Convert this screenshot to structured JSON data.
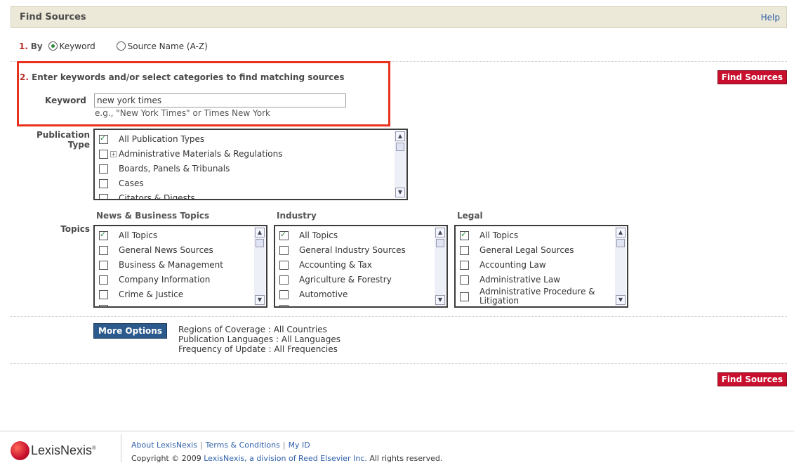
{
  "header": {
    "title": "Find Sources",
    "help": "Help"
  },
  "by": {
    "step": "1.",
    "label": "By",
    "options": [
      {
        "label": "Keyword",
        "selected": true
      },
      {
        "label": "Source Name (A-Z)",
        "selected": false
      }
    ]
  },
  "step2": {
    "num": "2.",
    "text": "Enter keywords and/or select categories to find matching sources"
  },
  "find_button": "Find Sources",
  "keyword": {
    "label": "Keyword",
    "value": "new york times",
    "hint": "e.g., \"New York Times\" or Times New York"
  },
  "publication": {
    "label_line1": "Publication",
    "label_line2": "Type",
    "items": [
      {
        "label": "All Publication Types",
        "checked": true
      },
      {
        "label": "Administrative Materials & Regulations",
        "checked": false,
        "expandable": true
      },
      {
        "label": "Boards, Panels & Tribunals",
        "checked": false
      },
      {
        "label": "Cases",
        "checked": false
      },
      {
        "label": "Citators & Digests",
        "checked": false
      }
    ]
  },
  "topics": {
    "label": "Topics",
    "news": {
      "heading": "News & Business Topics",
      "items": [
        "All Topics",
        "General News Sources",
        "Business & Management",
        "Company Information",
        "Crime & Justice"
      ]
    },
    "industry": {
      "heading": "Industry",
      "items": [
        "All Topics",
        "General Industry Sources",
        "Accounting & Tax",
        "Agriculture & Forestry",
        "Automotive"
      ]
    },
    "legal": {
      "heading": "Legal",
      "items": [
        "All Topics",
        "General Legal Sources",
        "Accounting Law",
        "Administrative Law",
        "Administrative Procedure &",
        "Litigation"
      ]
    }
  },
  "more_options": {
    "button": "More Options",
    "lines": [
      "Regions of Coverage : All Countries",
      "Publication Languages : All Languages",
      "Frequency of Update : All Frequencies"
    ]
  },
  "footer": {
    "logo": "LexisNexis",
    "links": [
      "About LexisNexis",
      "Terms & Conditions",
      "My ID"
    ],
    "copyright_pre": "Copyright © 2009 ",
    "copyright_link": "LexisNexis, a division of Reed Elsevier Inc.",
    "copyright_post": " All rights reserved."
  },
  "colors": {
    "accent_red": "#c8102e",
    "highlight_box": "#e8321e",
    "button_blue": "#2c5a8c",
    "link_blue": "#2e5fa8"
  }
}
